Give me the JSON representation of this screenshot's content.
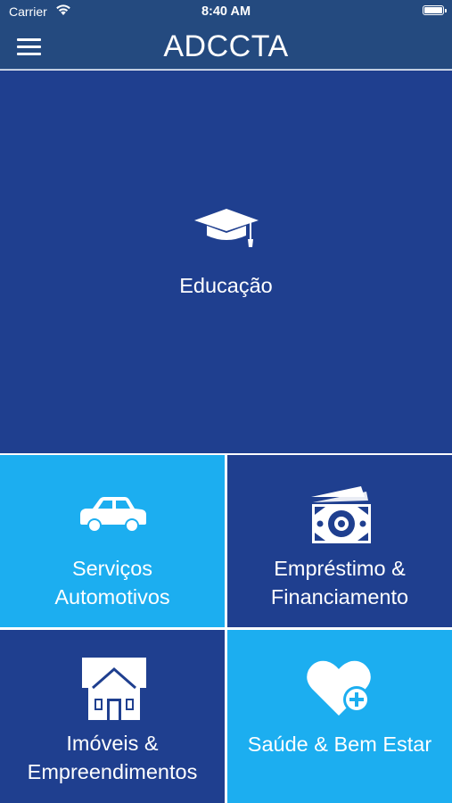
{
  "status_bar": {
    "carrier": "Carrier",
    "time": "8:40 AM"
  },
  "nav": {
    "title": "ADCCTA"
  },
  "tiles": [
    {
      "label": "Educação",
      "icon": "graduation-cap-icon",
      "color": "#1f3f8f"
    },
    {
      "label_line1": "Serviços",
      "label_line2": "Automotivos",
      "icon": "car-icon",
      "color": "#1caef0"
    },
    {
      "label_line1": "Empréstimo &",
      "label_line2": "Financiamento",
      "icon": "money-icon",
      "color": "#1f3f8f"
    },
    {
      "label_line1": "Imóveis &",
      "label_line2": "Empreendimentos",
      "icon": "house-icon",
      "color": "#1f3f8f"
    },
    {
      "label": "Saúde & Bem Estar",
      "icon": "heart-plus-icon",
      "color": "#1caef0"
    }
  ],
  "colors": {
    "nav_background": "#244a7f",
    "tile_dark": "#1f3f8f",
    "tile_light": "#1caef0"
  }
}
